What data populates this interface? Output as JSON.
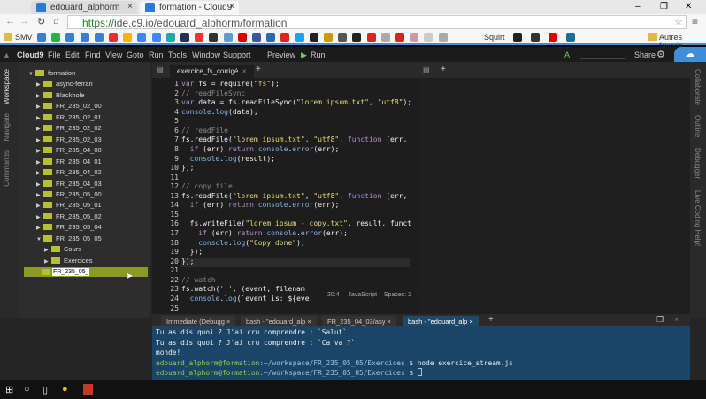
{
  "browser": {
    "tabs": [
      {
        "label": "edouard_alphorm",
        "active": false
      },
      {
        "label": "formation - Cloud9",
        "active": true
      }
    ],
    "url_scheme": "https://",
    "url_rest": "ide.c9.io/edouard_alphorm/formation",
    "bookmarks": {
      "first": "SMV",
      "squirt": "Squirt",
      "other": "Autres favoris"
    },
    "window_controls": [
      "–",
      "❐",
      "✕"
    ]
  },
  "ide": {
    "menu": [
      "Cloud9",
      "File",
      "Edit",
      "Find",
      "View",
      "Goto",
      "Run",
      "Tools",
      "Window",
      "Support"
    ],
    "preview": "Preview",
    "run": "Run",
    "share": "Share",
    "left_tabs": [
      "Workspace",
      "Navigate",
      "Commands"
    ],
    "right_tabs": [
      "Collaborate",
      "Outline",
      "Debugger",
      "Live Coding Help!"
    ],
    "tree": [
      {
        "label": "formation",
        "level": 0,
        "open": true
      },
      {
        "label": "async-ferrari",
        "level": 1
      },
      {
        "label": "Blackhole",
        "level": 1
      },
      {
        "label": "FR_235_02_00",
        "level": 1
      },
      {
        "label": "FR_235_02_01",
        "level": 1
      },
      {
        "label": "FR_235_02_02",
        "level": 1
      },
      {
        "label": "FR_235_02_03",
        "level": 1
      },
      {
        "label": "FR_235_04_00",
        "level": 1
      },
      {
        "label": "FR_235_04_01",
        "level": 1
      },
      {
        "label": "FR_235_04_02",
        "level": 1
      },
      {
        "label": "FR_235_04_03",
        "level": 1
      },
      {
        "label": "FR_235_05_00",
        "level": 1
      },
      {
        "label": "FR_235_05_01",
        "level": 1
      },
      {
        "label": "FR_235_05_02",
        "level": 1
      },
      {
        "label": "FR_235_05_04",
        "level": 1
      },
      {
        "label": "FR_235_05_05",
        "level": 1,
        "open": true
      },
      {
        "label": "Cours",
        "level": 2
      },
      {
        "label": "Exercices",
        "level": 2
      }
    ],
    "rename_input": "FR_235_05_",
    "editor_tab": "exercice_fs_corrigé.",
    "code": [
      "var fs = require(\"fs\");",
      "// readFileSync",
      "var data = fs.readFileSync(\"lorem ipsum.txt\", \"utf8\");",
      "console.log(data);",
      "",
      "// readFile",
      "fs.readFile(\"lorem ipsum.txt\", \"utf8\", function (err,",
      "  if (err) return console.error(err);",
      "  console.log(result);",
      "});",
      "",
      "// copy file",
      "fs.readFile(\"lorem ipsum.txt\", \"utf8\", function (err,",
      "  if (err) return console.error(err);",
      "",
      "  fs.writeFile(\"lorem ipsum - copy.txt\", result, funct",
      "    if (err) return console.error(err);",
      "    console.log(\"Copy done\");",
      "  });",
      "});",
      "",
      "// watch",
      "fs.watch('.', (event, filenam",
      "  console.log(`event is: ${eve"
    ],
    "status": {
      "pos": "20:4",
      "lang": "JavaScript",
      "spaces": "Spaces: 2"
    },
    "bottom_tabs": [
      "Immediate (Debugg",
      "bash - \"edouard_alp",
      "FR_235_04_03/asy",
      "bash - \"edouard_alp"
    ],
    "terminal": {
      "lines": [
        "Tu as dis quoi ? J'ai cru comprendre : `Salut`",
        "Tu as dis quoi ? J'ai cru comprendre : `Ca va ?`",
        "monde!"
      ],
      "prompts": [
        {
          "user": "edouard_alphorm@formation",
          "path": ":~/workspace/FR_235_05_05/Exercices",
          "cmd": " $ node exercice_stream.js"
        },
        {
          "user": "edouard_alphorm@formation",
          "path": ":~/workspace/FR_235_05_05/Exercices",
          "cmd": " $ "
        }
      ]
    }
  },
  "colors": {
    "accent": "#3f8fd8",
    "folder": "#b6c034",
    "terminal_bg": "#1a4566"
  }
}
